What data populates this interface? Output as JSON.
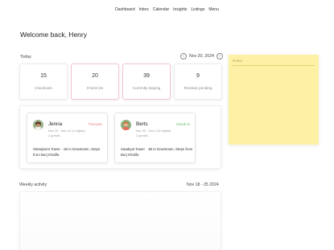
{
  "nav": [
    "Dashboard",
    "Inbox",
    "Calendar",
    "Insights",
    "Listings",
    "Menu"
  ],
  "welcome": "Welcome back, Henry",
  "today": {
    "label": "Today",
    "prev_icon": "chevron-left-icon",
    "date": "Nov 20, 2024",
    "next_icon": "chevron-right-icon"
  },
  "stats": [
    {
      "value": "15",
      "label": "Checkouts"
    },
    {
      "value": "20",
      "label": "Check-ins"
    },
    {
      "value": "39",
      "label": "Currently staying"
    },
    {
      "value": "9",
      "label": "Reviews pending"
    }
  ],
  "guests": [
    {
      "name": "Jenna",
      "status": "Turnover",
      "status_color": "#e8737f",
      "dates": "Nov 20 - Nov 22 (4 nights)",
      "guests": "2 guests",
      "address": "Standpoint Tower · 1B in Downtown, Steps from Burj Khalifa"
    },
    {
      "name": "Berts",
      "status": "Check in",
      "status_color": "#5cb85c",
      "dates": "Nov 20 - Dec 4 (5 nights)",
      "guests": "2 guests",
      "address": "Saadiyat Tower · 1B in Downtown, Steps from Burj Khalifa"
    }
  ],
  "weekly": {
    "label": "Weekly activity",
    "range": "Nov 18 - 25 2024"
  },
  "notes": {
    "placeholder": "Notes"
  },
  "colors": {
    "accent_pink": "#f3c6cf",
    "notes_bg": "#fdf1a6"
  }
}
